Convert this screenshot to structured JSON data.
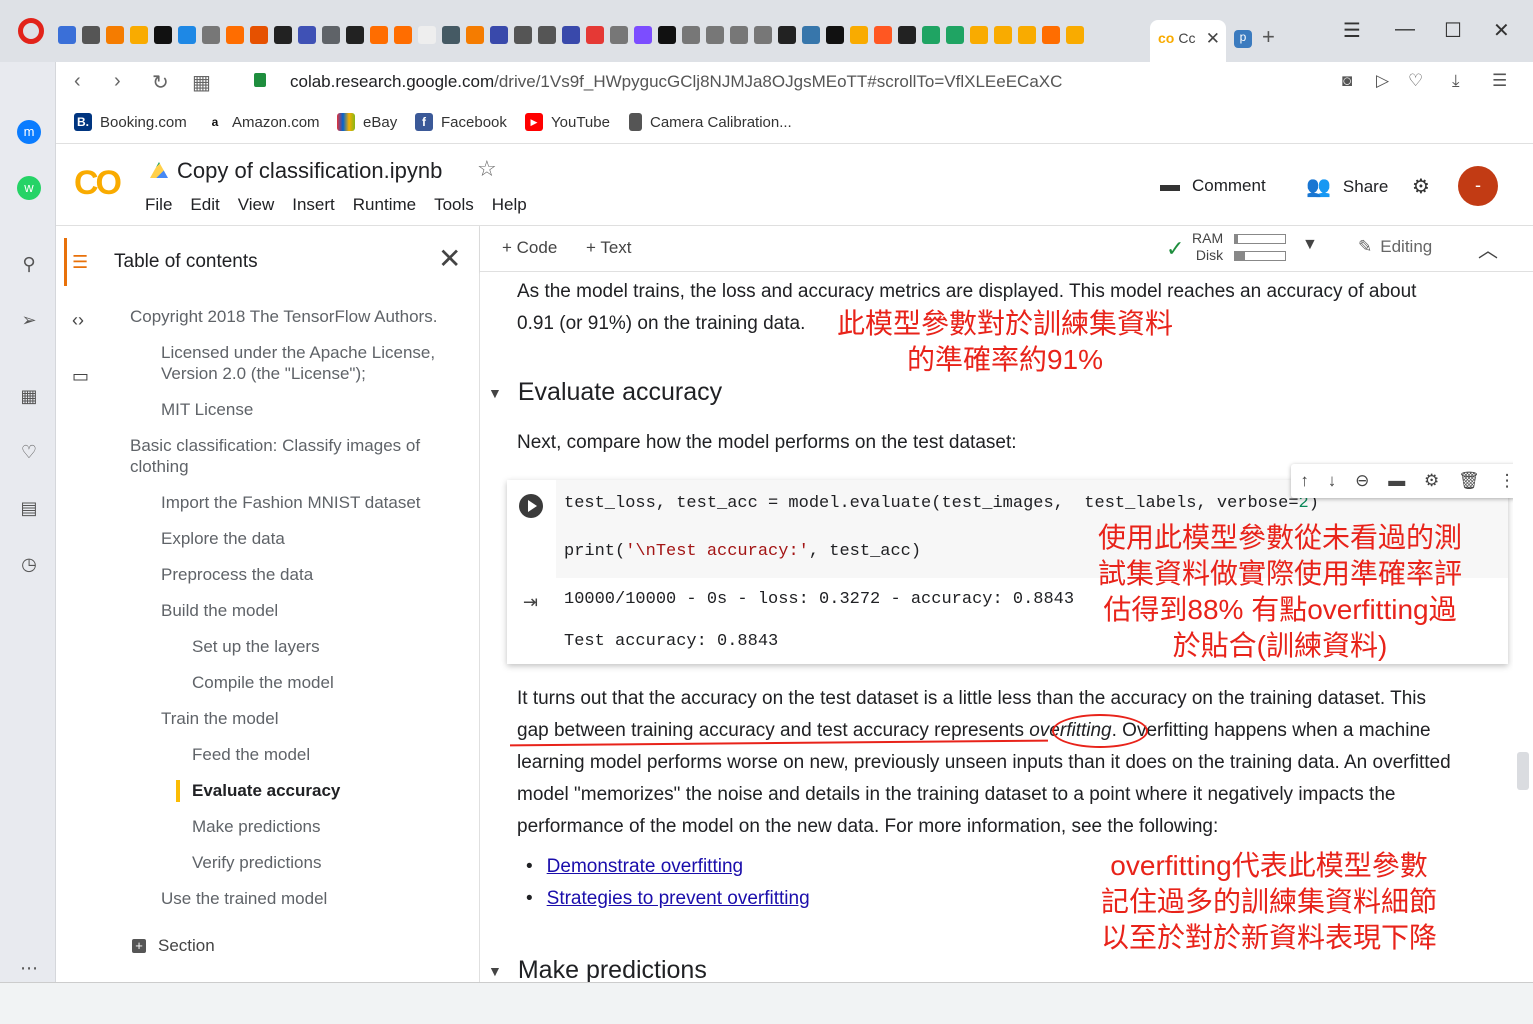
{
  "browser": {
    "url_host": "colab.research.google.com",
    "url_path": "/drive/1Vs9f_HWpygucGClj8NJMJa8OJgsMEoTT#scrollTo=VflXLEeECaXC",
    "active_tab_label": "Cc",
    "bookmarks": [
      {
        "label": "Booking.com",
        "icon": "B."
      },
      {
        "label": "Amazon.com",
        "icon": "a"
      },
      {
        "label": "eBay",
        "icon": ""
      },
      {
        "label": "Facebook",
        "icon": "f"
      },
      {
        "label": "YouTube",
        "icon": "▶"
      },
      {
        "label": "Camera Calibration...",
        "icon": ""
      }
    ]
  },
  "colab": {
    "logo": "CO",
    "title": "Copy of classification.ipynb",
    "menu": [
      "File",
      "Edit",
      "View",
      "Insert",
      "Runtime",
      "Tools",
      "Help"
    ],
    "comment_label": "Comment",
    "share_label": "Share",
    "avatar_letter": "-"
  },
  "toc": {
    "title": "Table of contents",
    "items": [
      {
        "label": "Copyright 2018 The TensorFlow Authors.",
        "level": 1
      },
      {
        "label": "Licensed under the Apache License, Version 2.0 (the \"License\");",
        "level": 2
      },
      {
        "label": "MIT License",
        "level": 2
      },
      {
        "label": "Basic classification: Classify images of clothing",
        "level": 1
      },
      {
        "label": "Import the Fashion MNIST dataset",
        "level": 2
      },
      {
        "label": "Explore the data",
        "level": 2
      },
      {
        "label": "Preprocess the data",
        "level": 2
      },
      {
        "label": "Build the model",
        "level": 2
      },
      {
        "label": "Set up the layers",
        "level": 3
      },
      {
        "label": "Compile the model",
        "level": 3
      },
      {
        "label": "Train the model",
        "level": 2
      },
      {
        "label": "Feed the model",
        "level": 3
      },
      {
        "label": "Evaluate accuracy",
        "level": 3
      },
      {
        "label": "Make predictions",
        "level": 3
      },
      {
        "label": "Verify predictions",
        "level": 3
      },
      {
        "label": "Use the trained model",
        "level": 2
      }
    ],
    "active_item": "Evaluate accuracy",
    "section_label": "Section"
  },
  "toolbar": {
    "code_label": "Code",
    "text_label": "Text",
    "ram_label": "RAM",
    "disk_label": "Disk",
    "ram_fraction": 0.05,
    "disk_fraction": 0.2,
    "editing_label": "Editing"
  },
  "notebook": {
    "intro_text_1": "As the model trains, the loss and accuracy metrics are displayed. This model reaches an accuracy of about",
    "intro_text_2": "0.91 (or 91%) on the training data.",
    "anno_train_1": "此模型參數對於訓練集資料",
    "anno_train_2": "的準確率約91%",
    "heading_evaluate": "Evaluate accuracy",
    "compare_text": "Next, compare how the model performs on the test dataset:",
    "code_line_1_a": "test_loss, test_acc = model.evaluate(test_images,  test_labels, verbose=",
    "code_line_1_num": "2",
    "code_line_1_b": ")",
    "code_line_2_a": "print(",
    "code_line_2_str": "'\\nTest accuracy:'",
    "code_line_2_b": ", test_acc)",
    "output_line_1": "10000/10000 - 0s - loss: 0.3272 - accuracy: 0.8843",
    "output_line_2": "Test accuracy: 0.8843",
    "anno_test_1": "使用此模型參數從未看過的測",
    "anno_test_2": "試集資料做實際使用準確率評",
    "anno_test_3": "估得到88% 有點overfitting過",
    "anno_test_4": "於貼合(訓練資料)",
    "para_1": "It turns out that the accuracy on the test dataset is a little less than the accuracy on the training dataset. This",
    "para_2a": "gap between training accuracy and test accuracy represents",
    "para_2_em": "overfitting",
    "para_2b": ". Overfitting happens when a machine",
    "para_3": "learning model performs worse on new, previously unseen inputs than it does on the training data. An overfitted",
    "para_4": "model \"memorizes\" the noise and details in the training dataset to a point where it negatively impacts the",
    "para_5": "performance of the model on the new data. For more information, see the following:",
    "link_1": "Demonstrate overfitting",
    "link_2": "Strategies to prevent overfitting",
    "anno_over_1": "overfitting代表此模型參數",
    "anno_over_2": "記住過多的訓練集資料細節",
    "anno_over_3": "以至於對於新資料表現下降",
    "heading_predictions": "Make predictions"
  },
  "colors": {
    "annotation_red": "#e8231a",
    "colab_orange": "#f9ab00",
    "avatar": "#c23b14",
    "link": "#1a0dab"
  }
}
